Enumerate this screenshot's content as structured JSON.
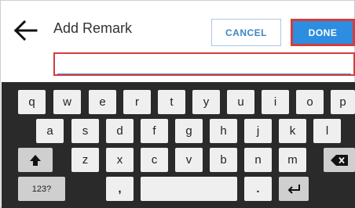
{
  "header": {
    "title": "Add Remark",
    "cancel_label": "CANCEL",
    "done_label": "DONE",
    "back_icon": "arrow-left-icon"
  },
  "remark": {
    "value": ""
  },
  "keyboard": {
    "row1": [
      "q",
      "w",
      "e",
      "r",
      "t",
      "y",
      "u",
      "i",
      "o",
      "p"
    ],
    "row2": [
      "a",
      "s",
      "d",
      "f",
      "g",
      "h",
      "j",
      "k",
      "l"
    ],
    "row3": [
      "z",
      "x",
      "c",
      "v",
      "b",
      "n",
      "m"
    ],
    "shift_icon": "shift-icon",
    "backspace_icon": "backspace-icon",
    "numbers_label": "123?",
    "comma_label": ",",
    "period_label": ".",
    "enter_icon": "enter-icon"
  },
  "colors": {
    "accent": "#2d8de0",
    "highlight": "#d63c3c",
    "keyboard_bg": "#2a2a2a",
    "key_bg": "#efefef"
  }
}
